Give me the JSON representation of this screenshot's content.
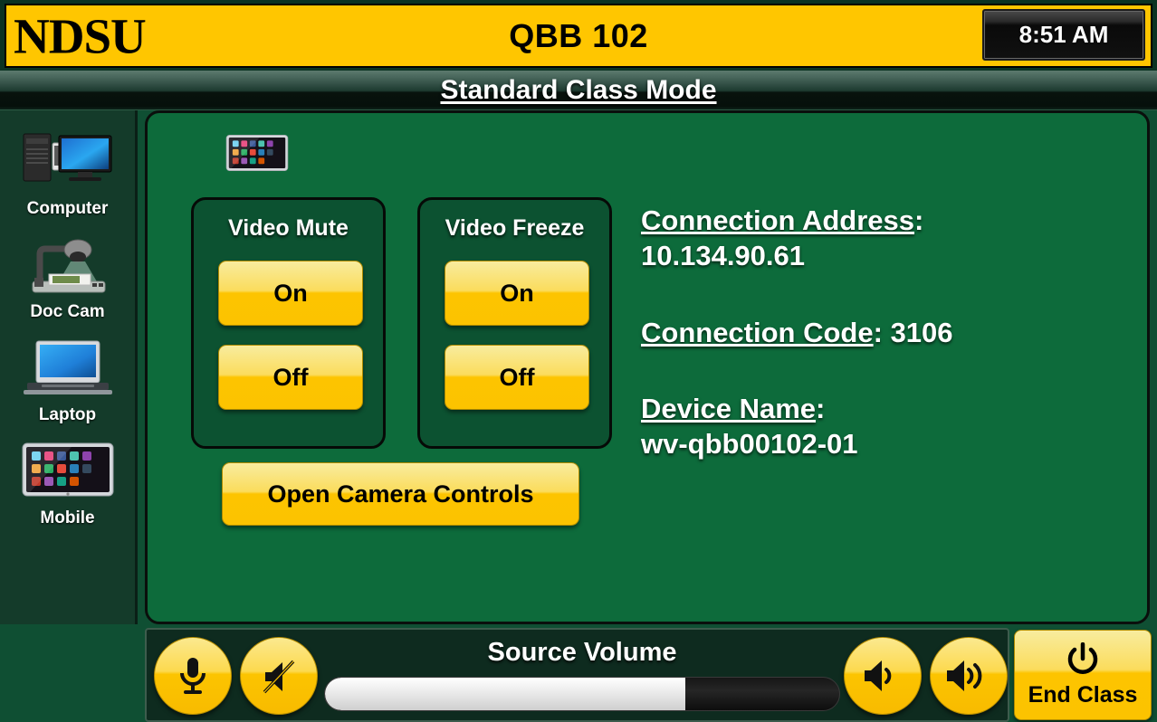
{
  "header": {
    "logo_text": "NDSU",
    "room_title": "QBB 102",
    "clock_time": "8:51 AM"
  },
  "mode_bar": {
    "label": "Standard Class Mode"
  },
  "sidebar": {
    "items": [
      {
        "label": "Computer",
        "icon": "desktop-computer-icon"
      },
      {
        "label": "Doc Cam",
        "icon": "document-camera-icon"
      },
      {
        "label": "Laptop",
        "icon": "laptop-icon"
      },
      {
        "label": "Mobile",
        "icon": "tablet-mobile-icon"
      }
    ]
  },
  "main": {
    "active_source_icon": "tablet-mobile-icon",
    "video_mute": {
      "title": "Video Mute",
      "on_label": "On",
      "off_label": "Off"
    },
    "video_freeze": {
      "title": "Video Freeze",
      "on_label": "On",
      "off_label": "Off"
    },
    "camera_controls_label": "Open Camera Controls",
    "info": {
      "connection_address_label": "Connection Address",
      "connection_address_value": "10.134.90.61",
      "connection_code_label": "Connection Code",
      "connection_code_value": "3106",
      "device_name_label": "Device Name",
      "device_name_value": "wv-qbb00102-01",
      "colon": ":"
    }
  },
  "bottom_bar": {
    "mic_icon": "microphone-icon",
    "mute_icon": "speaker-muted-icon",
    "volume_title": "Source Volume",
    "volume_percent": 70,
    "volume_down_icon": "volume-down-icon",
    "volume_up_icon": "volume-up-icon",
    "end_class_label": "End Class",
    "end_class_icon": "power-icon"
  },
  "colors": {
    "brand_yellow": "#FFC600",
    "panel_green": "#0d6b3b",
    "sidebar_green": "#143b2a",
    "button_gold": "#fcc400",
    "text_white": "#ffffff"
  }
}
